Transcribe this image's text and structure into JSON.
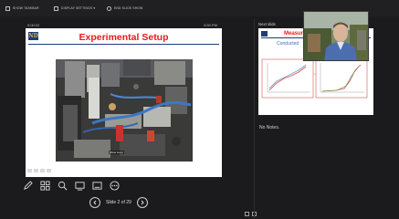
{
  "toolbar": {
    "buttons": [
      {
        "label": "SHOW TASKBAR",
        "icon": "taskbar-icon"
      },
      {
        "label": "DISPLAY SETTINGS ▾",
        "icon": "display-icon"
      },
      {
        "label": "END SLIDE SHOW",
        "icon": "end-show-icon"
      }
    ]
  },
  "presenter": {
    "elapsed_time": "0:00:22",
    "clock": "3:59 PM"
  },
  "current_slide": {
    "title": "Experimental Setup",
    "logo_text": "ND",
    "photo_caption": "[Flow loop]"
  },
  "navigation": {
    "slide_counter": "Slide 2 of 29"
  },
  "next_slide": {
    "label": "Next slide",
    "title": "Measur",
    "subtitle": "Conducted"
  },
  "notes": {
    "text": "No Notes."
  },
  "tools": [
    "pen-icon",
    "slide-sorter-icon",
    "zoom-icon",
    "pointer-icon",
    "subtitles-icon",
    "more-options-icon"
  ],
  "colors": {
    "background": "#1b1b1d",
    "title_red": "#e8191c",
    "nd_blue": "#1f3c78",
    "nd_gold": "#d4b25b"
  }
}
